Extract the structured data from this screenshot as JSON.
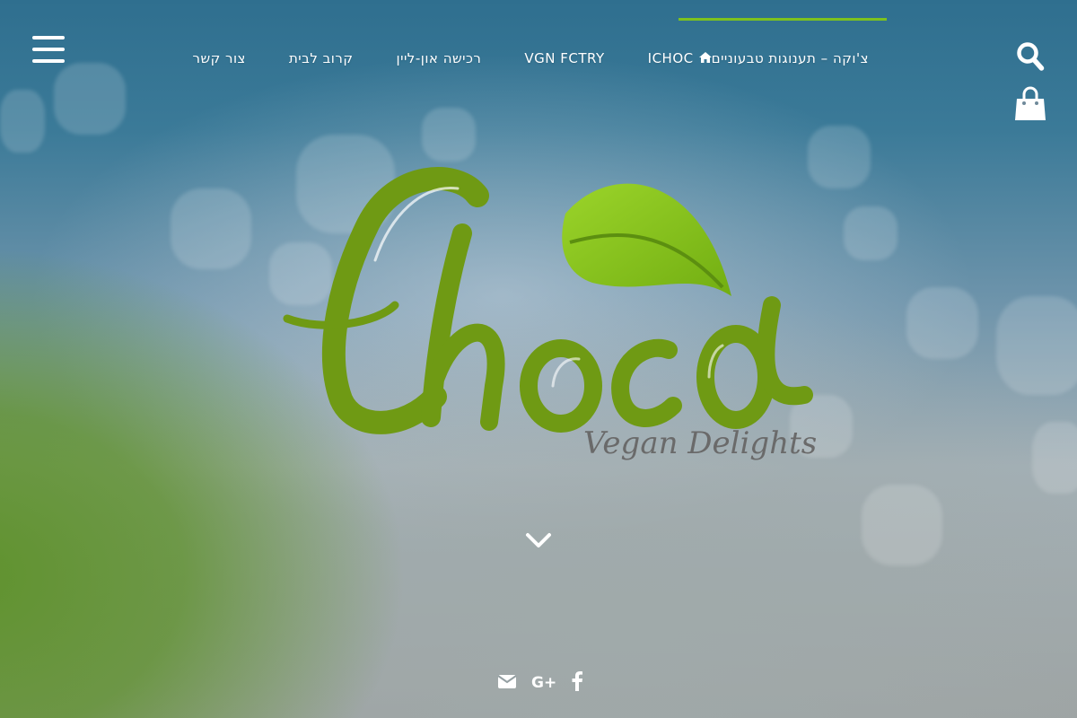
{
  "nav": {
    "items": [
      {
        "label": "צ'וקה – תענוגות טבעוניים",
        "icon": "home-icon"
      },
      {
        "label": "ICHOC"
      },
      {
        "label": "VGN FCTRY"
      },
      {
        "label": "רכישה און-ליין"
      },
      {
        "label": "קרוב לבית"
      },
      {
        "label": "צור קשר"
      }
    ]
  },
  "logo": {
    "title": "Choca",
    "tagline": "Vegan Delights"
  },
  "colors": {
    "accent": "#7dc21e",
    "logo_green": "#6f9a14",
    "leaf_green": "#86c21c",
    "tagline_gray": "#6a6a6a"
  },
  "icons": {
    "menu": "hamburger-menu-icon",
    "search": "search-icon",
    "cart": "shopping-bag-icon",
    "scroll": "chevron-down-icon",
    "social": [
      "envelope-icon",
      "google-plus-icon",
      "facebook-icon"
    ]
  },
  "social": {
    "google_plus_label": "G+"
  }
}
